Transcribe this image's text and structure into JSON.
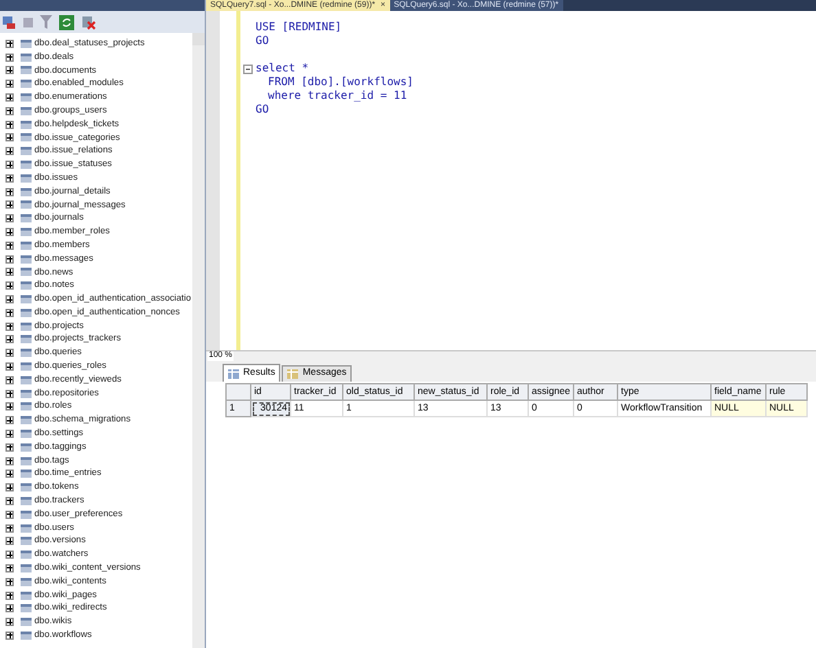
{
  "object_explorer": {
    "tables": [
      {
        "name": "dbo.deal_statuses_projects",
        "expanded": false
      },
      {
        "name": "dbo.deals",
        "expanded": false
      },
      {
        "name": "dbo.documents",
        "expanded": false
      },
      {
        "name": "dbo.enabled_modules",
        "expanded": false
      },
      {
        "name": "dbo.enumerations",
        "expanded": false
      },
      {
        "name": "dbo.groups_users",
        "expanded": false
      },
      {
        "name": "dbo.helpdesk_tickets",
        "expanded": false
      },
      {
        "name": "dbo.issue_categories",
        "expanded": false
      },
      {
        "name": "dbo.issue_relations",
        "expanded": false
      },
      {
        "name": "dbo.issue_statuses",
        "expanded": false
      },
      {
        "name": "dbo.issues",
        "expanded": false
      },
      {
        "name": "dbo.journal_details",
        "expanded": false
      },
      {
        "name": "dbo.journal_messages",
        "expanded": false
      },
      {
        "name": "dbo.journals",
        "expanded": false
      },
      {
        "name": "dbo.member_roles",
        "expanded": false
      },
      {
        "name": "dbo.members",
        "expanded": false
      },
      {
        "name": "dbo.messages",
        "expanded": false
      },
      {
        "name": "dbo.news",
        "expanded": false
      },
      {
        "name": "dbo.notes",
        "expanded": false
      },
      {
        "name": "dbo.open_id_authentication_associatio",
        "expanded": false
      },
      {
        "name": "dbo.open_id_authentication_nonces",
        "expanded": false
      },
      {
        "name": "dbo.projects",
        "expanded": false
      },
      {
        "name": "dbo.projects_trackers",
        "expanded": false
      },
      {
        "name": "dbo.queries",
        "expanded": false
      },
      {
        "name": "dbo.queries_roles",
        "expanded": false
      },
      {
        "name": "dbo.recently_vieweds",
        "expanded": false
      },
      {
        "name": "dbo.repositories",
        "expanded": false
      },
      {
        "name": "dbo.roles",
        "expanded": false
      },
      {
        "name": "dbo.schema_migrations",
        "expanded": false
      },
      {
        "name": "dbo.settings",
        "expanded": false
      },
      {
        "name": "dbo.taggings",
        "expanded": false
      },
      {
        "name": "dbo.tags",
        "expanded": false
      },
      {
        "name": "dbo.time_entries",
        "expanded": false
      },
      {
        "name": "dbo.tokens",
        "expanded": false
      },
      {
        "name": "dbo.trackers",
        "expanded": false
      },
      {
        "name": "dbo.user_preferences",
        "expanded": false
      },
      {
        "name": "dbo.users",
        "expanded": false
      },
      {
        "name": "dbo.versions",
        "expanded": false
      },
      {
        "name": "dbo.watchers",
        "expanded": false
      },
      {
        "name": "dbo.wiki_content_versions",
        "expanded": false
      },
      {
        "name": "dbo.wiki_contents",
        "expanded": false
      },
      {
        "name": "dbo.wiki_pages",
        "expanded": false
      },
      {
        "name": "dbo.wiki_redirects",
        "expanded": false
      },
      {
        "name": "dbo.wikis",
        "expanded": false
      },
      {
        "name": "dbo.workflows",
        "expanded": false
      }
    ]
  },
  "editor_tabs": [
    {
      "label": "SQLQuery7.sql - Xo...DMINE (redmine (59))*",
      "selected": true,
      "close": "×"
    },
    {
      "label": "SQLQuery6.sql - Xo...DMINE (redmine (57))*",
      "selected": false
    }
  ],
  "code_blocks": [
    {
      "foldable": false,
      "lines": [
        {
          "text": "USE [REDMINE]",
          "kind": "statement"
        },
        {
          "text": "GO",
          "kind": "statement"
        }
      ]
    },
    {
      "foldable": true,
      "lines": [
        {
          "text": "select *",
          "kind": "statement"
        },
        {
          "text": "FROM [dbo].[workflows]",
          "kind": "clause"
        },
        {
          "text": "where tracker_id = 11",
          "kind": "clause"
        },
        {
          "text": "GO",
          "kind": "statement"
        }
      ]
    }
  ],
  "zoom": "100 %",
  "result_tabs": [
    {
      "label": "Results",
      "selected": true
    },
    {
      "label": "Messages",
      "selected": false
    }
  ],
  "results": {
    "columns": [
      "id",
      "tracker_id",
      "old_status_id",
      "new_status_id",
      "role_id",
      "assignee",
      "author",
      "type",
      "field_name",
      "rule"
    ],
    "rows": [
      {
        "number": "1",
        "cells": [
          "30124",
          "11",
          "1",
          "13",
          "13",
          "0",
          "0",
          "WorkflowTransition",
          "NULL",
          "NULL"
        ]
      }
    ]
  }
}
